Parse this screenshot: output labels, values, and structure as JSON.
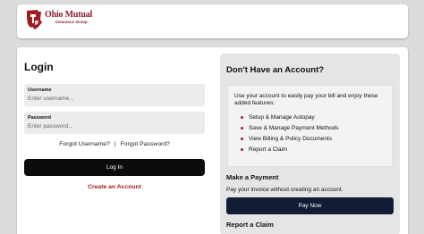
{
  "header": {
    "logo_name": "Ohio Mutual",
    "logo_sub": "Insurance Group",
    "brand_color": "#8d1d2a"
  },
  "login": {
    "title": "Login",
    "username_label": "Username",
    "username_placeholder": "Enter username...",
    "password_label": "Password",
    "password_placeholder": "Enter password...",
    "forgot_username": "Forgot Username?",
    "separator": "|",
    "forgot_password": "Forgot Password?",
    "login_button": "Log In",
    "create_account": "Create an Account"
  },
  "no_account": {
    "title": "Don't Have an Account?",
    "description": "Use your account to easily pay your bill and enjoy these added features:",
    "features": [
      "Setup & Manage Autopay",
      "Save & Manage Payment Methods",
      "View Billing & Policy Documents",
      "Report a Claim"
    ]
  },
  "make_payment": {
    "title": "Make a Payment",
    "description": "Pay your invoice without creating an account.",
    "button": "Pay Now"
  },
  "report_claim": {
    "title": "Report a Claim"
  },
  "colors": {
    "accent_red": "#a01c24",
    "pay_button": "#131c35",
    "login_button": "#0c0c0c"
  }
}
